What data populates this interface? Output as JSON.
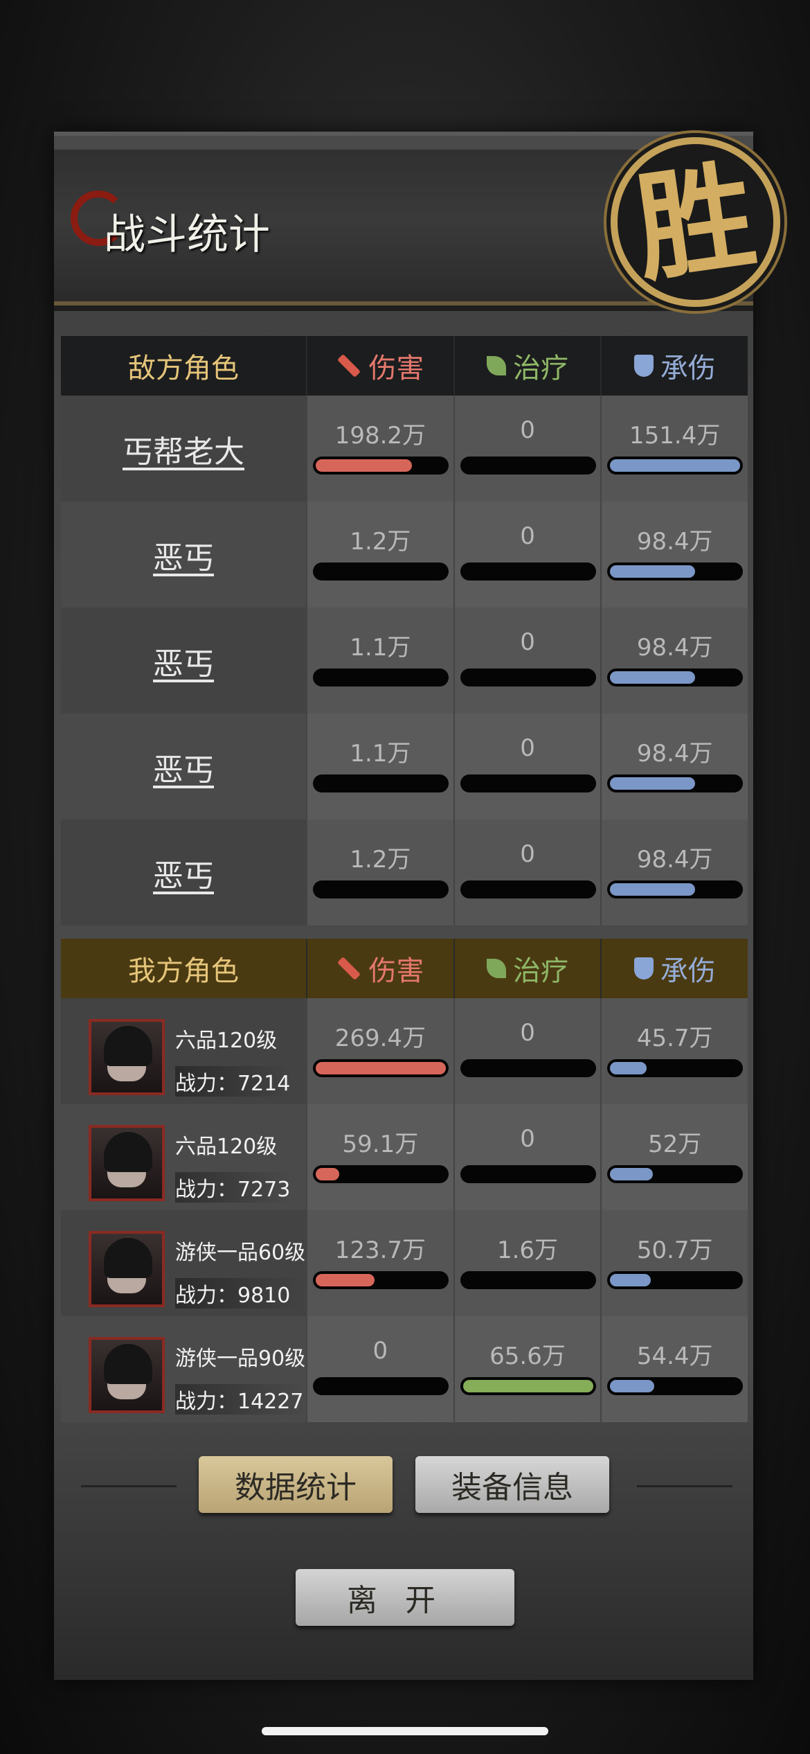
{
  "title": "战斗统计",
  "seal": "胜",
  "columns": {
    "damage": "伤害",
    "heal": "治疗",
    "tank": "承伤"
  },
  "enemy": {
    "header": "敌方角色",
    "rows": [
      {
        "name": "丐帮老大",
        "damage": "198.2万",
        "heal": "0",
        "tank": "151.4万",
        "damage_pct": 0.74,
        "heal_pct": 0,
        "tank_pct": 1.0
      },
      {
        "name": "恶丐",
        "damage": "1.2万",
        "heal": "0",
        "tank": "98.4万",
        "damage_pct": 0,
        "heal_pct": 0,
        "tank_pct": 0.65
      },
      {
        "name": "恶丐",
        "damage": "1.1万",
        "heal": "0",
        "tank": "98.4万",
        "damage_pct": 0,
        "heal_pct": 0,
        "tank_pct": 0.65
      },
      {
        "name": "恶丐",
        "damage": "1.1万",
        "heal": "0",
        "tank": "98.4万",
        "damage_pct": 0,
        "heal_pct": 0,
        "tank_pct": 0.65
      },
      {
        "name": "恶丐",
        "damage": "1.2万",
        "heal": "0",
        "tank": "98.4万",
        "damage_pct": 0,
        "heal_pct": 0,
        "tank_pct": 0.65
      }
    ]
  },
  "ally": {
    "header": "我方角色",
    "rows": [
      {
        "rank": "六品120级",
        "power": "战力：7214",
        "damage": "269.4万",
        "heal": "0",
        "tank": "45.7万",
        "damage_pct": 1.0,
        "heal_pct": 0,
        "tank_pct": 0.28
      },
      {
        "rank": "六品120级",
        "power": "战力：7273",
        "damage": "59.1万",
        "heal": "0",
        "tank": "52万",
        "damage_pct": 0.18,
        "heal_pct": 0,
        "tank_pct": 0.33
      },
      {
        "rank": "游侠一品60级",
        "power": "战力：9810",
        "damage": "123.7万",
        "heal": "1.6万",
        "tank": "50.7万",
        "damage_pct": 0.45,
        "heal_pct": 0,
        "tank_pct": 0.31
      },
      {
        "rank": "游侠一品90级",
        "power": "战力：14227",
        "damage": "0",
        "heal": "65.6万",
        "tank": "54.4万",
        "damage_pct": 0,
        "heal_pct": 1.0,
        "tank_pct": 0.34
      }
    ]
  },
  "buttons": {
    "stats": "数据统计",
    "equipment": "装备信息",
    "leave": "离开"
  }
}
